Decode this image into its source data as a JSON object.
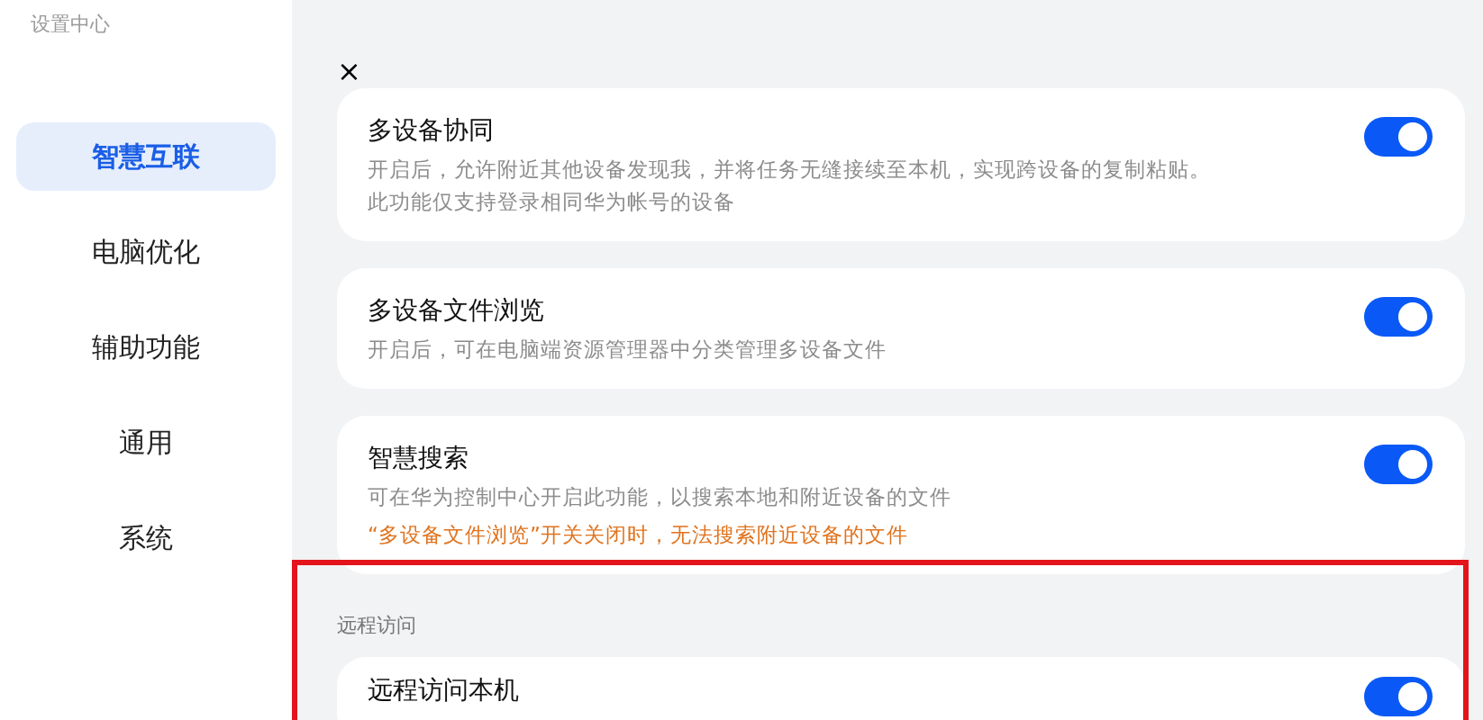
{
  "window": {
    "title": "设置中心",
    "close": "×"
  },
  "sidebar": {
    "items": [
      {
        "label": "智慧互联",
        "selected": true
      },
      {
        "label": "电脑优化",
        "selected": false
      },
      {
        "label": "辅助功能",
        "selected": false
      },
      {
        "label": "通用",
        "selected": false
      },
      {
        "label": "系统",
        "selected": false
      }
    ]
  },
  "settings": [
    {
      "kind": "card",
      "title": "多设备协同",
      "lines": [
        "开启后，允许附近其他设备发现我，并将任务无缝接续至本机，实现跨设备的复制粘贴。",
        "此功能仅支持登录相同华为帐号的设备"
      ],
      "on": true
    },
    {
      "kind": "card",
      "title": "多设备文件浏览",
      "lines": [
        "开启后，可在电脑端资源管理器中分类管理多设备文件"
      ],
      "on": true
    },
    {
      "kind": "card",
      "title": "智慧搜索",
      "lines": [
        "可在华为控制中心开启此功能，以搜索本地和附近设备的文件"
      ],
      "warning": "“多设备文件浏览”开关关闭时，无法搜索附近设备的文件",
      "on": true
    },
    {
      "kind": "section",
      "title": "远程访问"
    },
    {
      "kind": "card",
      "title": "远程访问本机",
      "on": true
    }
  ]
}
